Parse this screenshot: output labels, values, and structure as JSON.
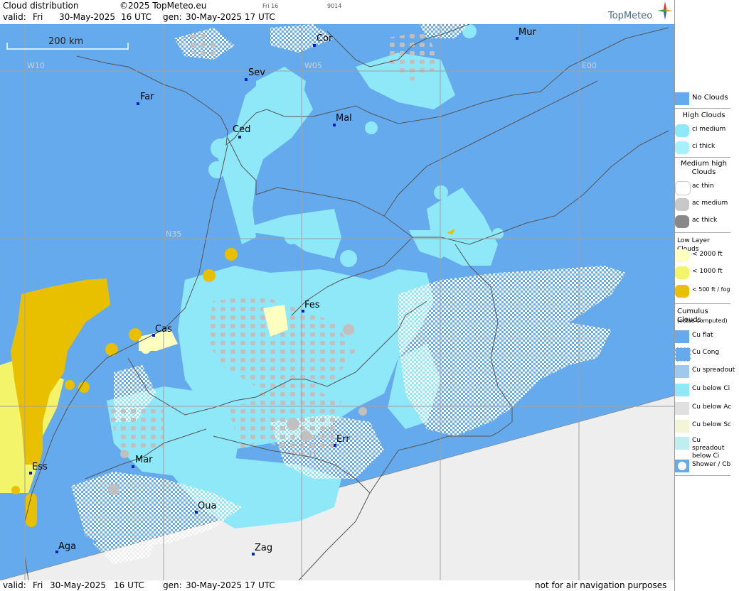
{
  "header": {
    "title": "Cloud distribution",
    "copyright": "©2025 TopMeteo.eu",
    "tag1": "Fri 16",
    "tag2": "9014",
    "valid_label": "valid:",
    "valid_day": "Fri",
    "valid_date": "30-May-2025",
    "valid_time": "16 UTC",
    "gen_label": "gen:",
    "gen_value": "30-May-2025 17 UTC",
    "brand": "TopMeteo"
  },
  "footer": {
    "valid_label": "valid:",
    "valid_day": "Fri",
    "valid_date": "30-May-2025",
    "valid_time": "16 UTC",
    "gen_label": "gen:",
    "gen_value": "30-May-2025 17 UTC",
    "note": "not for air navigation purposes"
  },
  "scale_label": "200 km",
  "grid_labels": {
    "w10": "W10",
    "w05": "W05",
    "e00": "E00",
    "n35": "N35"
  },
  "cities": {
    "cor": "Cor",
    "mur": "Mur",
    "sev": "Sev",
    "far": "Far",
    "mal": "Mal",
    "ced": "Ced",
    "fes": "Fes",
    "cas": "Cas",
    "err": "Err",
    "mar": "Mar",
    "ess": "Ess",
    "oua": "Oua",
    "aga": "Aga",
    "zag": "Zag"
  },
  "legend": {
    "no_clouds": "No Clouds",
    "high_clouds": "High Clouds",
    "ci_medium": "ci medium",
    "ci_thick": "ci thick",
    "medium_high": "Medium high Clouds",
    "ac_thin": "ac thin",
    "ac_medium": "ac medium",
    "ac_thick": "ac thick",
    "low_layer": "Low Layer Clouds",
    "lt2000": "< 2000 ft",
    "lt1000": "< 1000 ft",
    "lt500": "< 500 ft / fog",
    "cumulus": "Cumulus Clouds",
    "octas": "(octas computed)",
    "cu_flat": "Cu flat",
    "cu_cong": "Cu Cong",
    "cu_spreadout": "Cu spreadout",
    "cu_below_ci": "Cu below Ci",
    "cu_below_ac": "Cu below Ac",
    "cu_below_sc": "Cu below Sc",
    "cu_spreadout_below_ci": "Cu spreadout below Ci",
    "shower_cb": "Shower / Cb"
  },
  "colors": {
    "no_clouds": "#66aaee",
    "ci": "#8ee8f8",
    "ac_thin": "#ffffff",
    "ac_medium": "#c8c8c8",
    "low_2000": "#ffffc0",
    "low_1000": "#f4f46a",
    "fog": "#e8c000",
    "outside": "#eeeeee"
  }
}
